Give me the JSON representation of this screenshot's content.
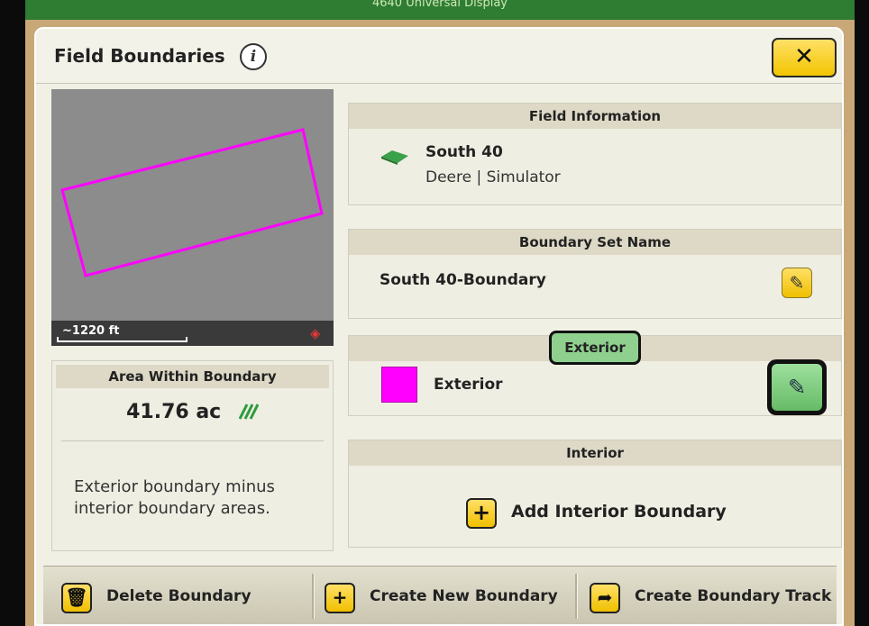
{
  "window": {
    "title_partial": "4640 Universal Display"
  },
  "dialog": {
    "title": "Field Boundaries",
    "info_glyph": "i",
    "close_glyph": "✕"
  },
  "map": {
    "scale_label": "~1220 ft",
    "boundary_color": "#ff00ff",
    "north_glyph": "◈"
  },
  "area": {
    "header": "Area Within Boundary",
    "value": "41.76 ac",
    "note": "Exterior boundary minus interior boundary areas."
  },
  "field_info": {
    "header": "Field Information",
    "field_name": "South 40",
    "org": "Deere | Simulator",
    "icon": "field-icon"
  },
  "boundary_set": {
    "header": "Boundary Set Name",
    "name": "South 40-Boundary",
    "edit_glyph": "✎"
  },
  "exterior": {
    "tag": "Exterior",
    "label": "Exterior",
    "color": "#ff00ff",
    "edit_glyph": "✎"
  },
  "interior": {
    "header": "Interior",
    "add_label": "Add Interior Boundary",
    "add_glyph": "+"
  },
  "footer": {
    "delete_label": "Delete Boundary",
    "delete_glyph": "🗑",
    "create_label": "Create New Boundary",
    "create_glyph": "+",
    "track_label": "Create Boundary Track",
    "track_glyph": "➦"
  }
}
